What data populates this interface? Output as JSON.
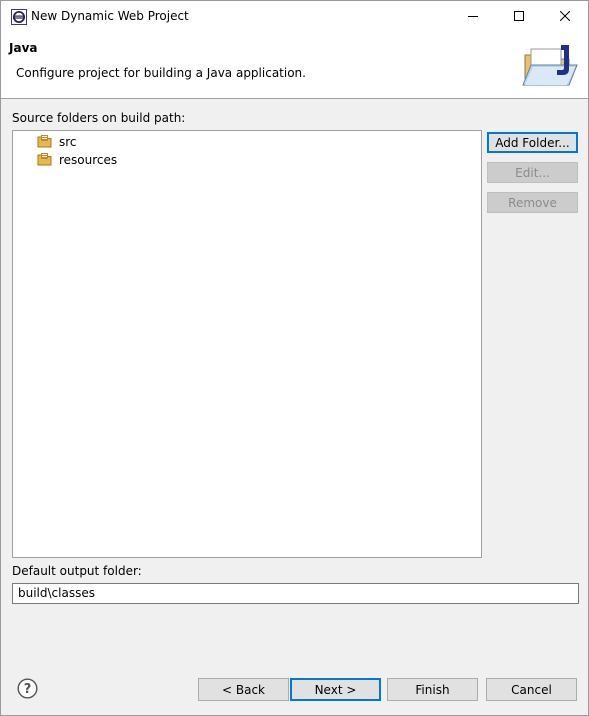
{
  "window": {
    "title": "New Dynamic Web Project",
    "controls": {
      "minimize": "minimize",
      "maximize": "maximize",
      "close": "close"
    }
  },
  "banner": {
    "title": "Java",
    "description": "Configure project for building a Java application."
  },
  "source": {
    "label": "Source folders on build path:",
    "folders": [
      {
        "name": "src",
        "icon": "source-folder-icon"
      },
      {
        "name": "resources",
        "icon": "source-folder-icon"
      }
    ]
  },
  "buttons": {
    "add_folder": "Add Folder...",
    "edit": "Edit...",
    "remove": "Remove"
  },
  "output": {
    "label": "Default output folder:",
    "value": "build\\classes"
  },
  "footer": {
    "back": "< Back",
    "next": "Next >",
    "finish": "Finish",
    "cancel": "Cancel"
  },
  "colors": {
    "accent": "#0078d7",
    "window_bg": "#f0f0f0",
    "folder": "#e8b84a"
  }
}
